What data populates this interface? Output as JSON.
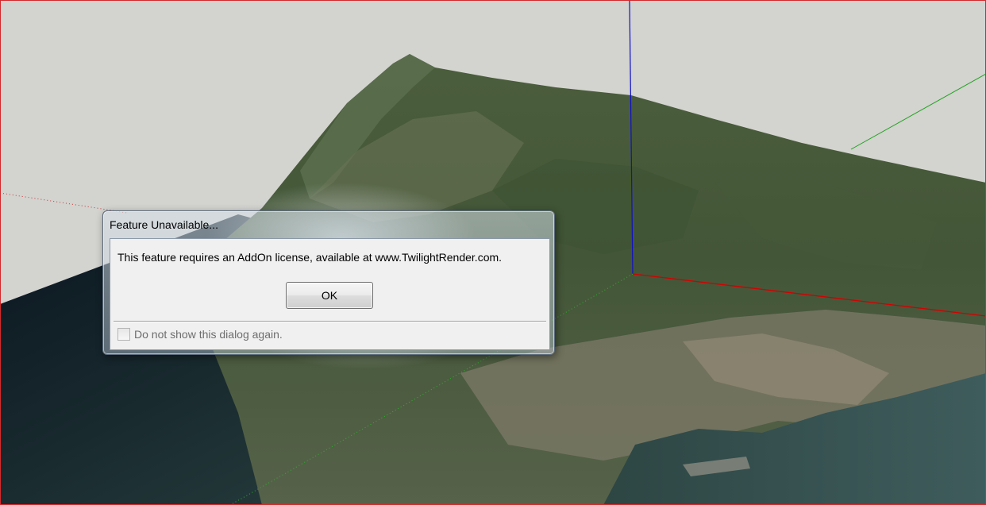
{
  "dialog": {
    "title": "Feature Unavailable...",
    "message": "This feature requires an AddOn license, available at www.TwilightRender.com.",
    "ok_label": "OK",
    "checkbox_label": "Do not show this dialog again.",
    "checkbox_checked": false,
    "checkbox_enabled": false
  },
  "scene": {
    "sky_color": "#d3d3cf",
    "axis_colors": {
      "red": "#d40000",
      "green": "#1fa31f",
      "blue": "#1010c8"
    },
    "terrain_colors": [
      "#3d5233",
      "#4d6040",
      "#5a6a4a",
      "#253a38",
      "#0e1a22"
    ],
    "viewport_border_color": "#d4292c"
  }
}
